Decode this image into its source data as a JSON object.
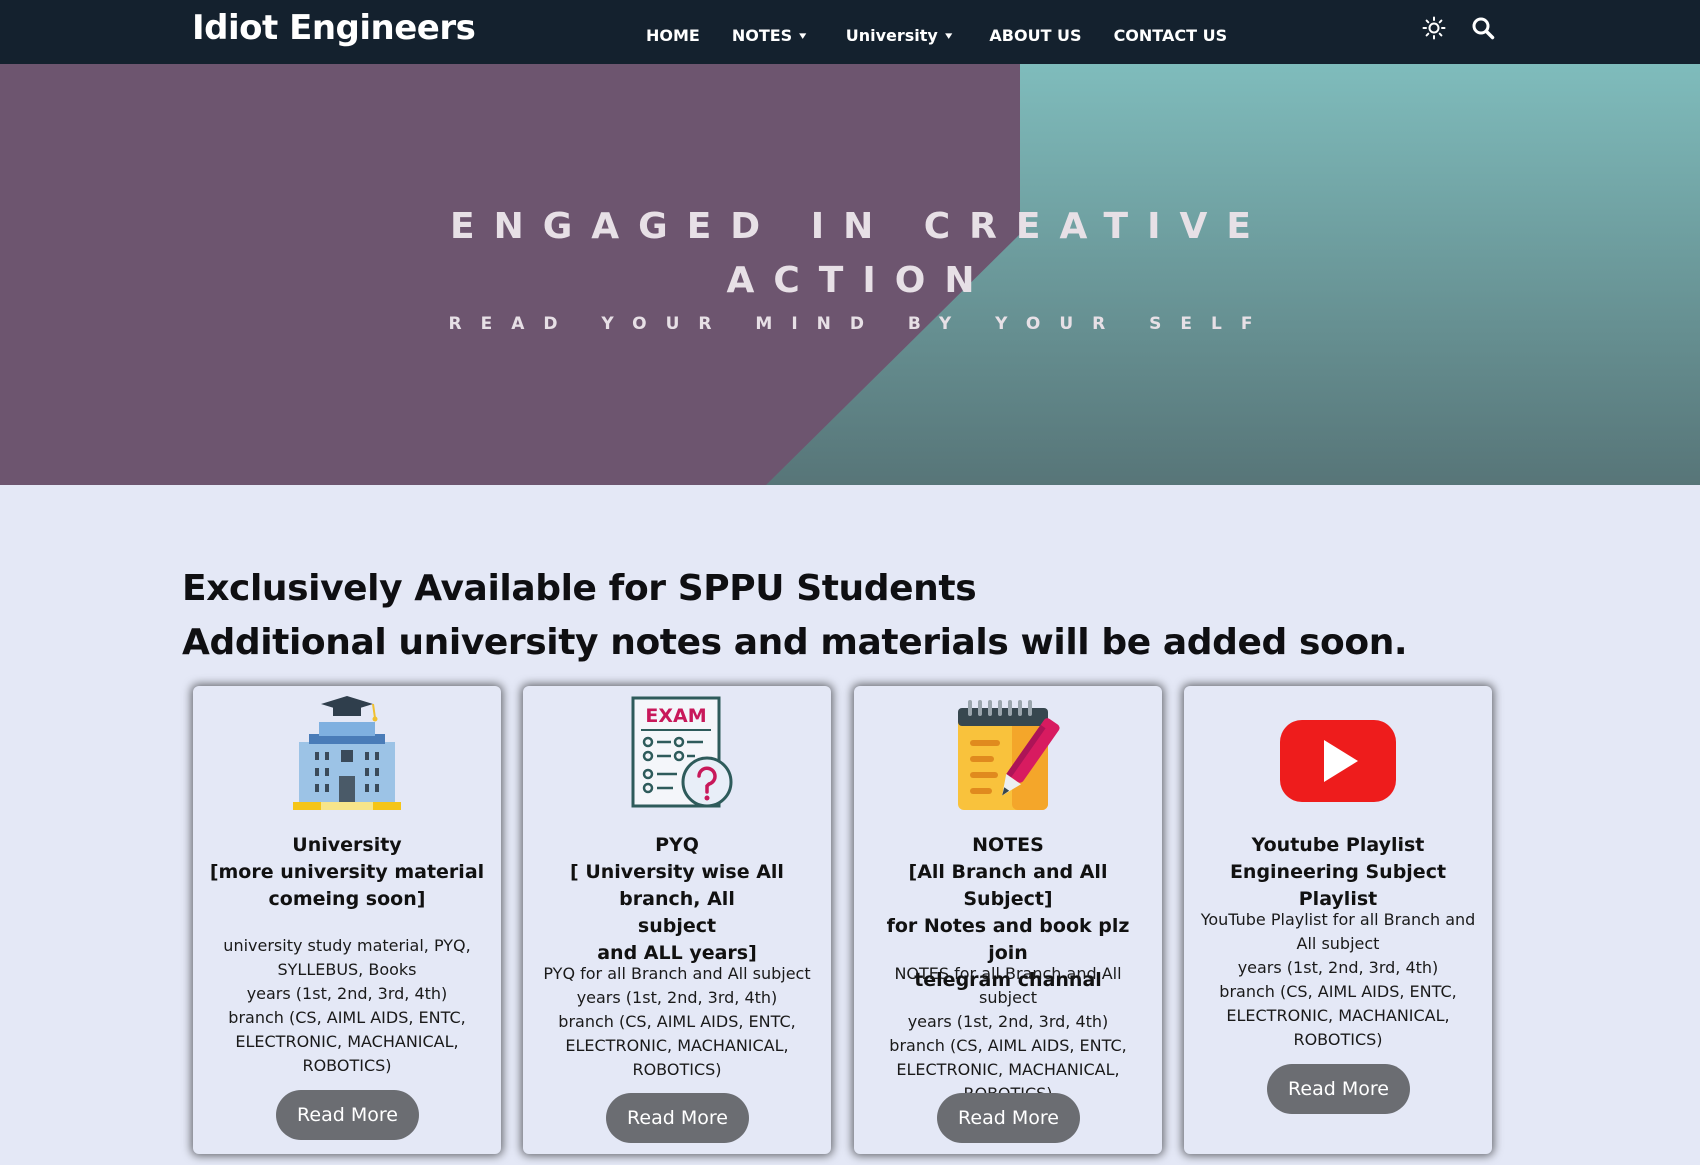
{
  "nav": {
    "brand": "Idiot Engineers",
    "items": [
      {
        "label": "HOME"
      },
      {
        "label": "NOTES"
      },
      {
        "label": "University"
      },
      {
        "label": "ABOUT US"
      },
      {
        "label": "CONTACT US"
      }
    ],
    "theme_icon": "sun-icon",
    "search_icon": "search-icon",
    "chevron": "▾"
  },
  "hero": {
    "line1": "ENGAGED IN CREATIVE",
    "line2": "ACTION",
    "subtitle": "READ YOUR MIND BY YOUR SELF",
    "colors": {
      "left": "#6d556f",
      "right_top": "#7fbcbc",
      "right_bottom": "#577578"
    }
  },
  "section": {
    "heading1": "Exclusively Available for SPPU Students",
    "heading2": "Additional university notes and materials will be added soon."
  },
  "cards": [
    {
      "icon": "university-building-icon",
      "title_lines": [
        "University",
        "[more university material",
        "comeing soon]"
      ],
      "desc_lines": [
        "university study material, PYQ,",
        "SYLLEBUS, Books",
        "years (1st, 2nd, 3rd, 4th)",
        "branch (CS, AIML AIDS, ENTC,",
        "ELECTRONIC, MACHANICAL,",
        "ROBOTICS)"
      ],
      "button": "Read More"
    },
    {
      "icon": "exam-paper-icon",
      "icon_text": "EXAM",
      "title_lines": [
        "PYQ",
        "[ University wise All branch, All",
        "subject",
        "and ALL years]"
      ],
      "desc_lines": [
        "PYQ for all Branch and All subject",
        "years (1st, 2nd, 3rd, 4th)",
        "branch (CS, AIML AIDS, ENTC,",
        "ELECTRONIC, MACHANICAL,",
        "ROBOTICS)"
      ],
      "button": "Read More"
    },
    {
      "icon": "notepad-pen-icon",
      "title_lines": [
        "NOTES",
        "[All Branch and All Subject]",
        "for Notes and book plz join",
        "telegram channal"
      ],
      "desc_lines": [
        "NOTES for all Branch and All subject",
        "years (1st, 2nd, 3rd, 4th)",
        "branch (CS, AIML AIDS, ENTC,",
        "ELECTRONIC, MACHANICAL,",
        "ROBOTICS)"
      ],
      "button": "Read More"
    },
    {
      "icon": "youtube-play-icon",
      "title_lines": [
        "Youtube Playlist",
        "Engineering Subject Playlist"
      ],
      "desc_lines": [
        "YouTube Playlist for all Branch and",
        "All subject",
        "years (1st, 2nd, 3rd, 4th)",
        "branch (CS, AIML AIDS, ENTC,",
        "ELECTRONIC, MACHANICAL,",
        "ROBOTICS)"
      ],
      "button": "Read More"
    }
  ]
}
